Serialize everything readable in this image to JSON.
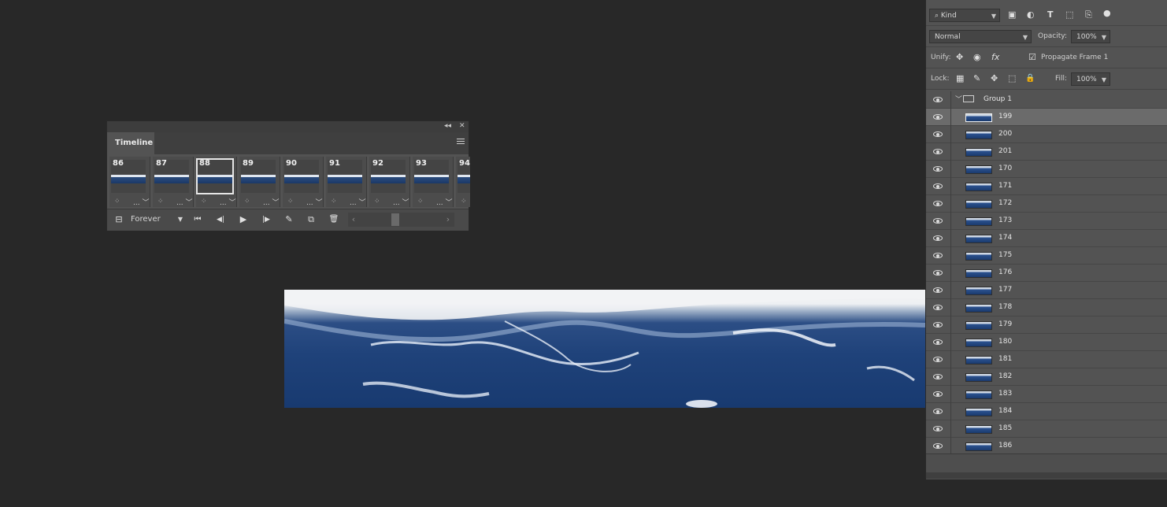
{
  "timeline": {
    "tab_label": "Timeline",
    "collapse_icon": "double-chevron-left-icon",
    "close_icon": "close-icon",
    "menu_icon": "hamburger-menu-icon",
    "frames": [
      {
        "number": "86",
        "delay": "..."
      },
      {
        "number": "87",
        "delay": "..."
      },
      {
        "number": "88",
        "delay": "...",
        "selected": true
      },
      {
        "number": "89",
        "delay": "..."
      },
      {
        "number": "90",
        "delay": "..."
      },
      {
        "number": "91",
        "delay": "..."
      },
      {
        "number": "92",
        "delay": "..."
      },
      {
        "number": "93",
        "delay": "..."
      },
      {
        "number": "94",
        "delay": "..."
      }
    ],
    "loop_option": "Forever",
    "controls": {
      "convert_icon": "⊟",
      "first_frame_icon": "⏮",
      "prev_frame_icon": "◀|",
      "play_icon": "▶",
      "next_frame_icon": "|▶",
      "tween_icon": "✎",
      "duplicate_icon": "⧉",
      "delete_icon": "🗑"
    },
    "scroll_left": "‹",
    "scroll_right": "›"
  },
  "layers_panel": {
    "filter_kind": "Kind",
    "filter_icons": {
      "image": "▣",
      "adjust": "◐",
      "type": "T",
      "shape": "⬚",
      "smart": "⎘"
    },
    "blend_mode": "Normal",
    "opacity_label": "Opacity:",
    "opacity_value": "100%",
    "unify_label": "Unify:",
    "unify_icons": {
      "position": "✥",
      "visibility": "◉",
      "style": "fx"
    },
    "propagate_label": "Propagate Frame 1",
    "propagate_checked": true,
    "lock_label": "Lock:",
    "lock_icons": {
      "pixels": "▦",
      "paint": "✎",
      "move": "✥",
      "artboard": "⬚",
      "all": "🔒"
    },
    "fill_label": "Fill:",
    "fill_value": "100%",
    "group_name": "Group 1",
    "layers": [
      "199",
      "200",
      "201",
      "170",
      "171",
      "172",
      "173",
      "174",
      "175",
      "176",
      "177",
      "178",
      "179",
      "180",
      "181",
      "182",
      "183",
      "184",
      "185",
      "186"
    ],
    "selected_layer": "199"
  },
  "colors": {
    "workspace": "#282828",
    "panel": "#535353",
    "selected_row": "#6b6b6b",
    "ocean": "#1f427a"
  }
}
